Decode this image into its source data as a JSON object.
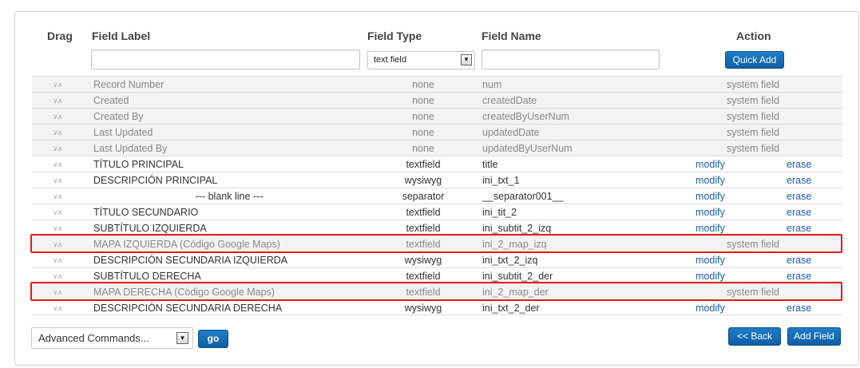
{
  "headers": {
    "drag": "Drag",
    "label": "Field Label",
    "type": "Field Type",
    "name": "Field Name",
    "action": "Action"
  },
  "quick_add": {
    "label_value": "",
    "type_selected": "text field",
    "name_value": "",
    "button": "Quick Add"
  },
  "rows": [
    {
      "label": "Record Number",
      "type": "none",
      "name": "num",
      "system": "system field",
      "kind": "sys"
    },
    {
      "label": "Created",
      "type": "none",
      "name": "createdDate",
      "system": "system field",
      "kind": "sys"
    },
    {
      "label": "Created By",
      "type": "none",
      "name": "createdByUserNum",
      "system": "system field",
      "kind": "sys"
    },
    {
      "label": "Last Updated",
      "type": "none",
      "name": "updatedDate",
      "system": "system field",
      "kind": "sys"
    },
    {
      "label": "Last Updated By",
      "type": "none",
      "name": "updatedByUserNum",
      "system": "system field",
      "kind": "sys"
    },
    {
      "label": "TÍTULO PRINCIPAL",
      "type": "textfield",
      "name": "title",
      "modify": "modify",
      "erase": "erase",
      "kind": "usr"
    },
    {
      "label": "DESCRIPCIÓN PRINCIPAL",
      "type": "wysiwyg",
      "name": "ini_txt_1",
      "modify": "modify",
      "erase": "erase",
      "kind": "usr"
    },
    {
      "label": "--- blank line ---",
      "type": "separator",
      "name": "__separator001__",
      "modify": "modify",
      "erase": "erase",
      "kind": "usr"
    },
    {
      "label": "TÍTULO SECUNDARIO",
      "type": "textfield",
      "name": "ini_tit_2",
      "modify": "modify",
      "erase": "erase",
      "kind": "usr"
    },
    {
      "label": "SUBTÍTULO IZQUIERDA",
      "type": "textfield",
      "name": "ini_subtit_2_izq",
      "modify": "modify",
      "erase": "erase",
      "kind": "usr"
    },
    {
      "label": "MAPA IZQUIERDA (Código Google Maps)",
      "type": "textfield",
      "name": "ini_2_map_izq",
      "system": "system field",
      "kind": "sys"
    },
    {
      "label": "DESCRIPCIÓN SECUNDARIA IZQUIERDA",
      "type": "wysiwyg",
      "name": "ini_txt_2_izq",
      "modify": "modify",
      "erase": "erase",
      "kind": "usr"
    },
    {
      "label": "SUBTÍTULO DERECHA",
      "type": "textfield",
      "name": "ini_subtit_2_der",
      "modify": "modify",
      "erase": "erase",
      "kind": "usr"
    },
    {
      "label": "MAPA DERECHA (Código Google Maps)",
      "type": "textfield",
      "name": "ini_2_map_der",
      "system": "system field",
      "kind": "sys"
    },
    {
      "label": "DESCRIPCIÓN SECUNDARIA DERECHA",
      "type": "wysiwyg",
      "name": "ini_txt_2_der",
      "modify": "modify",
      "erase": "erase",
      "kind": "usr"
    }
  ],
  "drag_glyph": "∨∧",
  "footer": {
    "advanced": "Advanced Commands...",
    "go": "go",
    "back": "<< Back",
    "add_field": "Add Field"
  },
  "colors": {
    "accent": "#1570bd",
    "link": "#1a5fae",
    "highlight": "#e8191a"
  }
}
